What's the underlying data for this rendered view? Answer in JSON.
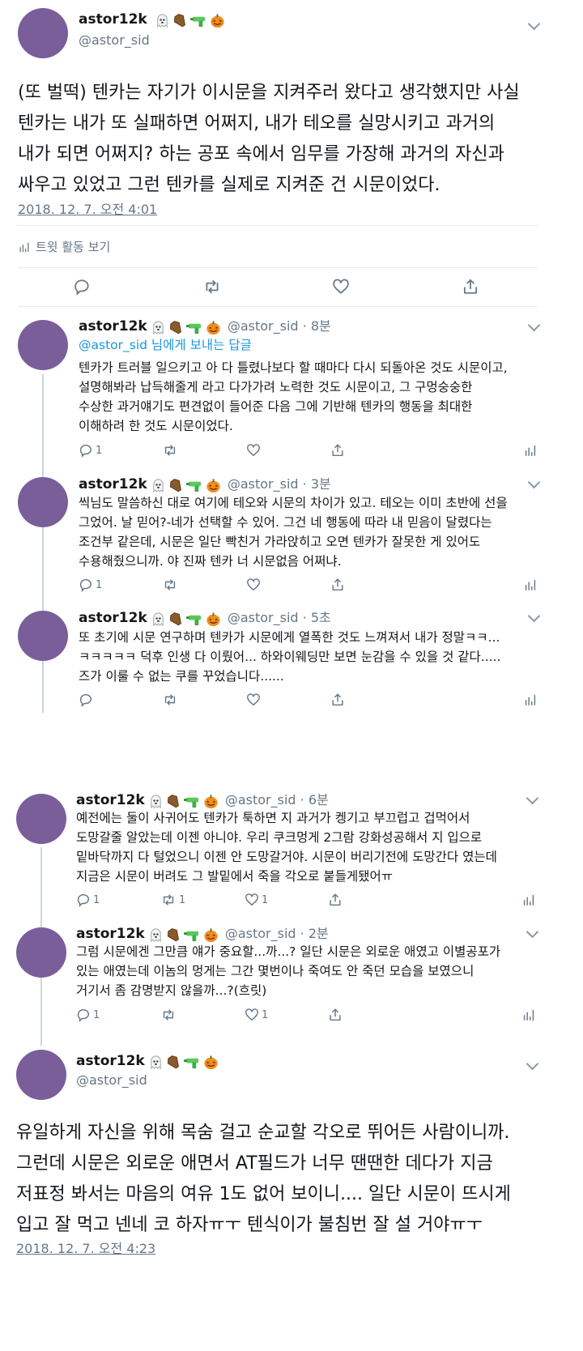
{
  "colors": {
    "avatar": "#7a5e9a",
    "link": "#1b95e0",
    "muted": "#657786",
    "divider": "#e6ecf0"
  },
  "icons": [
    "ghost-icon",
    "coffin-icon",
    "water-gun-icon",
    "jack-o-lantern-icon",
    "chevron-down-icon",
    "reply-icon",
    "retweet-icon",
    "like-icon",
    "share-icon",
    "analytics-icon"
  ],
  "main_tweet": {
    "display_name": "astor12k",
    "handle": "@astor_sid",
    "lines": [
      "(또 벌떡) 텐카는 자기가 이시문을 지켜주러 왔다고 생각했지만 사실",
      "텐카는 내가 또 실패하면 어쩌지, 내가 테오를 실망시키고 과거의",
      "내가 되면 어쩌지? 하는 공포 속에서 임무를 가장해 과거의 자신과",
      "싸우고 있었고 그런 텐카를 실제로 지켜준 건 시문이었다."
    ],
    "timestamp": "2018. 12. 7. 오전 4:01",
    "activity_label": "트윗 활동 보기"
  },
  "replies": [
    {
      "display_name": "astor12k",
      "handle": "@astor_sid",
      "time": "8분",
      "reply_to_handle": "@astor_sid",
      "reply_to_suffix": " 님에게 보내는 답글",
      "lines": [
        "텐카가 트러블 일으키고 아 다 틀렸나보다 할 때마다 다시 되돌아온 것도 시문이고,",
        "설명해봐라 납득해줄게 라고 다가가려 노력한 것도 시문이고, 그 구멍숭숭한",
        "수상한 과거얘기도 편견없이 들어준 다음 그에 기반해 텐카의 행동을 최대한",
        "이해하려 한 것도 시문이었다."
      ],
      "reply_count": "1",
      "retweet_count": "",
      "like_count": ""
    },
    {
      "display_name": "astor12k",
      "handle": "@astor_sid",
      "time": "3분",
      "lines": [
        "씩님도 말씀하신 대로 여기에 테오와 시문의 차이가 있고. 테오는 이미 초반에 선을",
        "그었어. 날 믿어?-네가 선택할 수 있어. 그건 네 행동에 따라 내 믿음이 달렸다는",
        "조건부 같은데, 시문은 일단 빡친거 가라앉히고 오면 텐카가 잘못한 게 있어도",
        "수용해줬으니까. 야 진짜 텐카 너 시문없음 어쩌냐."
      ],
      "reply_count": "1",
      "retweet_count": "",
      "like_count": ""
    },
    {
      "display_name": "astor12k",
      "handle": "@astor_sid",
      "time": "5초",
      "lines": [
        "또 초기에 시문 연구하며 텐카가 시문에게 열폭한 것도 느껴져서 내가 정말ㅋㅋ...",
        "ㅋㅋㅋㅋㅋ 덕후 인생 다 이뤘어... 하와이웨딩만 보면 눈감을 수 있을 것 같다.....",
        "즈가 이룰 수 없는 쿠를 꾸었습니다......"
      ],
      "reply_count": "",
      "retweet_count": "",
      "like_count": ""
    },
    {
      "display_name": "astor12k",
      "handle": "@astor_sid",
      "time": "6분",
      "lines": [
        "예전에는 둘이 사귀어도 텐카가 툭하면 지 과거가 켕기고 부끄럽고 겁먹어서",
        "도망갈줄 알았는데 이젠 아니야. 우리 쿠크멍게 2그람 강화성공해서 지 입으로",
        "밑바닥까지 다 털었으니 이젠 안 도망갈거야. 시문이 버리기전에 도망간다 였는데",
        "지금은 시문이 버려도 그 발밑에서 죽을 각오로 붙들게됐어ㅠ"
      ],
      "reply_count": "1",
      "retweet_count": "1",
      "like_count": "1"
    },
    {
      "display_name": "astor12k",
      "handle": "@astor_sid",
      "time": "2분",
      "lines": [
        "그럼 시문에겐 그만큼 얘가 중요할...까...? 일단 시문은 외로운 애였고 이별공포가",
        "있는 애였는데 이놈의 멍게는 그간 몇번이나 죽여도 안 죽던 모습을 보였으니",
        "거기서 좀 감명받지 않을까...?(흐릿)"
      ],
      "reply_count": "1",
      "retweet_count": "",
      "like_count": "1"
    }
  ],
  "final_tweet": {
    "display_name": "astor12k",
    "handle": "@astor_sid",
    "lines": [
      "유일하게 자신을 위해 목숨 걸고 순교할 각오로 뛰어든 사람이니까.",
      "그런데 시문은 외로운 애면서 AT필드가 너무 땐땐한 데다가 지금",
      "저표정 봐서는 마음의 여유 1도 없어 보이니.... 일단 시문이 뜨시게",
      "입고 잘 먹고 넨네 코 하자ㅠㅜ 텐식이가 불침번 잘 설 거야ㅠㅜ"
    ],
    "timestamp": "2018. 12. 7. 오전 4:23"
  }
}
